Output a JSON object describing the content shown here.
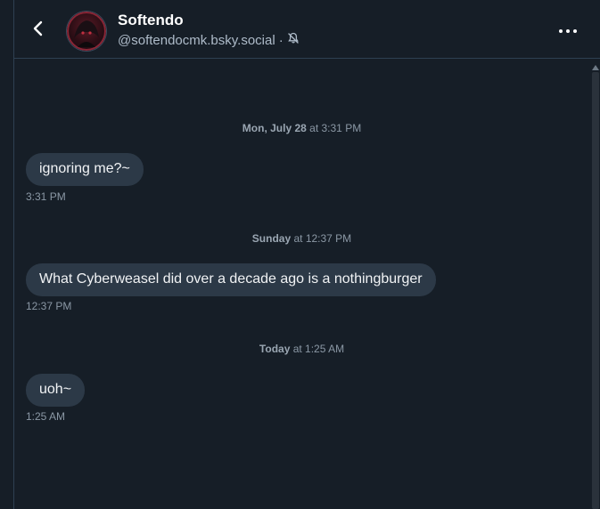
{
  "header": {
    "display_name": "Softendo",
    "handle": "@softendocmk.bsky.social",
    "separator": "·"
  },
  "icons": {
    "back": "chevron-left-icon",
    "muted": "bell-slash-icon",
    "more": "ellipsis-icon"
  },
  "messages": [
    {
      "date_bold": "Mon, July 28",
      "date_rest": " at 3:31 PM",
      "text": "ignoring me?~",
      "time": "3:31 PM"
    },
    {
      "date_bold": "Sunday",
      "date_rest": " at 12:37 PM",
      "text": "What Cyberweasel did over a decade ago is a nothingburger",
      "time": "12:37 PM"
    },
    {
      "date_bold": "Today",
      "date_rest": " at 1:25 AM",
      "text": "uoh~",
      "time": "1:25 AM"
    }
  ],
  "colors": {
    "background": "#161e27",
    "bubble": "#2c3947",
    "border": "#2e4052",
    "muted_text": "#8b98a5"
  }
}
